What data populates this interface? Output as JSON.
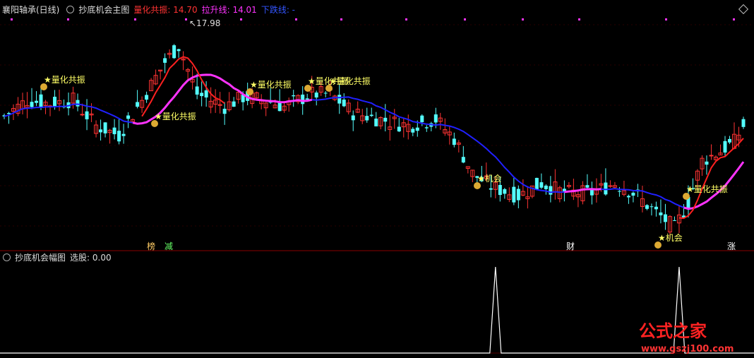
{
  "header_main": {
    "stock": "襄阳轴承(日线)",
    "indicator": "抄底机会主图",
    "items": [
      {
        "label": "量化共振: 14.70",
        "color": "#ff3333"
      },
      {
        "label": "拉升线: 14.01",
        "color": "#ff33ff"
      },
      {
        "label": "下跌线: -",
        "color": "#3355ff"
      }
    ]
  },
  "header_sub": {
    "indicator": "抄底机会幅图",
    "value": "选股: 0.00"
  },
  "price_high_label": "17.98",
  "signal_labels": [
    "量化共振",
    "量化共振",
    "量化共振",
    "量化共振",
    "量化共振",
    "量化共振",
    "机会",
    "机会"
  ],
  "bottom_tags": [
    "榜",
    "减",
    "财",
    "涨"
  ],
  "watermark": {
    "brand": "公式之家",
    "url": "www.gszj100.com"
  },
  "colors": {
    "up": "#ff3333",
    "down": "#54ffff",
    "fast": "#ff2020",
    "rise": "#ff33ff",
    "fall": "#2020ff",
    "signal": "#ffff66"
  },
  "chart_data": [
    {
      "type": "candlestick",
      "title": "抄底机会主图",
      "ylim": [
        10.9,
        18.2
      ],
      "max_price": 17.98,
      "series": [
        {
          "name": "量化共振",
          "last": 14.7
        },
        {
          "name": "拉升线",
          "last": 14.01
        },
        {
          "name": "下跌线",
          "last": null
        }
      ]
    },
    {
      "type": "line",
      "title": "抄底机会幅图",
      "series": [
        {
          "name": "选股",
          "last": 0.0,
          "spikes": [
            {
              "bar_index": 107,
              "value": 1
            },
            {
              "bar_index": 147,
              "value": 1
            }
          ]
        }
      ]
    }
  ]
}
